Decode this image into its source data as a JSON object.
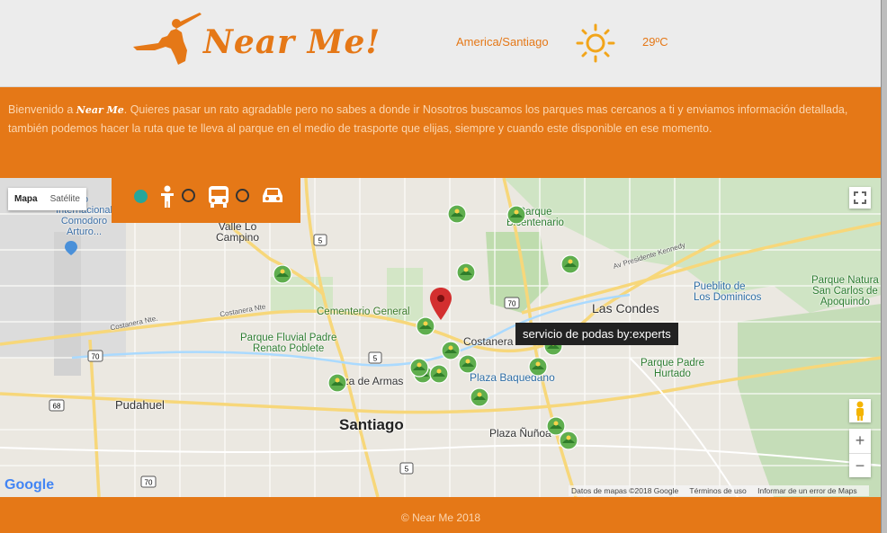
{
  "header": {
    "logo_text": "Near Me!",
    "timezone": "America/Santiago",
    "weather_icon": "sun-icon",
    "temperature": "29ºC"
  },
  "intro": {
    "prefix": "Bienvenido a ",
    "brand": "Near Me",
    "text": ". Quieres pasar un rato agradable pero no sabes a donde ir Nosotros buscamos los parques mas cercanos a ti y enviamos información detallada, también podemos hacer la ruta que te lleva al parque en el medio de trasporte que elijas, siempre y cuando este disponible en ese momento."
  },
  "map": {
    "type_control": {
      "map_label": "Mapa",
      "satellite_label": "Satélite",
      "selected": "Mapa"
    },
    "transport_modes": [
      {
        "icon": "walking-person-icon",
        "selected": true
      },
      {
        "icon": "bus-icon",
        "selected": false
      },
      {
        "icon": "car-icon",
        "selected": false
      }
    ],
    "accent_colors": {
      "orange": "#e57817",
      "teal": "#26a69a",
      "marker_red": "#d32f2f"
    },
    "tooltip": "servicio de podas by:experts",
    "zoom_in": "+",
    "zoom_out": "−",
    "labels": {
      "airport": "to\nInternacional\nComodoro\nArturo...",
      "valle_lo_campino": "Valle Lo\nCampino",
      "parque_bicentenario": "Parque\nBicentenario",
      "av_kennedy": "Av Presidente Kennedy",
      "cementerio_general": "Cementerio General",
      "costanera_norte_1": "Costanera Nte.",
      "costanera_norte_2": "Costanera Nte",
      "parque_renato_poblete": "Parque Fluvial Padre\nRenato Poblete",
      "costanera": "Costanera",
      "las_condes": "Las Condes",
      "pueblito_los_dominicos": "Pueblito de\nLos Dominicos",
      "parque_natural": "Parque Natura\nSan Carlos de\nApoquindo",
      "plaza_de_armas": "aza de Armas",
      "plaza_baquedano": "Plaza Baquedano",
      "parque_padre_hurtado": "Parque Padre\nHurtado",
      "pudahuel": "Pudahuel",
      "santiago": "Santiago",
      "plaza_nunoa": "Plaza Ñuñoa",
      "route_5a": "5",
      "route_70a": "70",
      "route_70b": "70",
      "route_5b": "5",
      "route_68": "68",
      "route_70c": "70",
      "route_5c": "5"
    },
    "google_logo": "Google",
    "attribution": {
      "data": "Datos de mapas ©2018 Google",
      "terms": "Términos de uso",
      "report": "Informar de un error de Maps"
    }
  },
  "footer": {
    "copyright": "© Near Me 2018"
  }
}
